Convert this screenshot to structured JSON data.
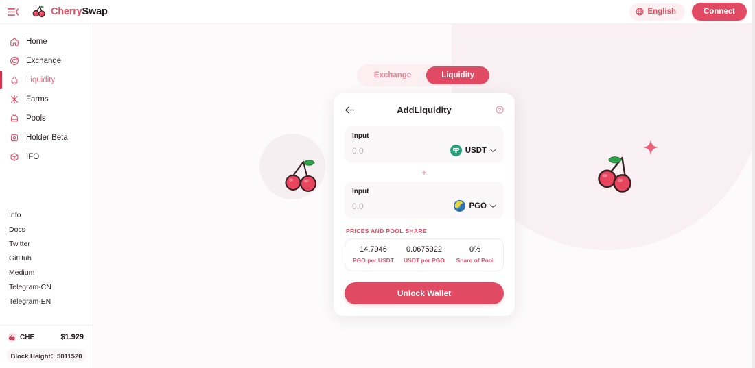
{
  "header": {
    "collapse_icon": "collapse-sidebar-icon",
    "brand": {
      "logo_icon": "cherry-logo-icon",
      "name_primary": "Cherry",
      "name_secondary": "Swap"
    },
    "language_button": {
      "label": "English",
      "icon": "globe-icon"
    },
    "connect_button": {
      "label": "Connect"
    }
  },
  "sidebar": {
    "nav_items": [
      {
        "label": "Home",
        "icon": "home-icon",
        "active": false
      },
      {
        "label": "Exchange",
        "icon": "exchange-icon",
        "active": false
      },
      {
        "label": "Liquidity",
        "icon": "liquidity-drop-icon",
        "active": true
      },
      {
        "label": "Farms",
        "icon": "farms-icon",
        "active": false
      },
      {
        "label": "Pools",
        "icon": "pools-icon",
        "active": false
      },
      {
        "label": "Holder Beta",
        "icon": "holder-lock-icon",
        "active": false
      },
      {
        "label": "IFO",
        "icon": "ifo-box-icon",
        "active": false
      }
    ],
    "links": [
      {
        "label": "Info"
      },
      {
        "label": "Docs"
      },
      {
        "label": "Twitter"
      },
      {
        "label": "GitHub"
      },
      {
        "label": "Medium"
      },
      {
        "label": "Telegram-CN"
      },
      {
        "label": "Telegram-EN"
      }
    ],
    "footer": {
      "token_icon": "che-token-icon",
      "token_symbol": "CHE",
      "token_price": "$1.929",
      "block_height": "Block Height：5011520"
    }
  },
  "main": {
    "tabs": [
      {
        "label": "Exchange",
        "active": false
      },
      {
        "label": "Liquidity",
        "active": true
      }
    ],
    "card": {
      "back_icon": "back-arrow-icon",
      "title": "AddLiquidity",
      "help_icon": "help-circle-icon",
      "inputs": [
        {
          "label": "Input",
          "value": "",
          "placeholder": "0.0",
          "token": {
            "symbol": "USDT",
            "icon": "usdt-token-icon",
            "color": "#26a17b"
          }
        },
        {
          "label": "Input",
          "value": "",
          "placeholder": "0.0",
          "token": {
            "symbol": "PGO",
            "icon": "pgo-token-icon",
            "color": "#2f6fb5"
          }
        }
      ],
      "plus_icon": "plus-icon",
      "prices_section_label": "PRICES AND POOL SHARE",
      "rates": [
        {
          "value": "14.7946",
          "label": "PGO per USDT"
        },
        {
          "value": "0.0675922",
          "label": "USDT per PGO"
        },
        {
          "value": "0%",
          "label": "Share of Pool"
        }
      ],
      "action_button": {
        "label": "Unlock Wallet"
      }
    },
    "decorations": {
      "cherry_left_icon": "cherry-illustration-icon",
      "cherry_right_icon": "cherry-illustration-icon",
      "sparkle_icon": "sparkle-icon"
    }
  },
  "theme": {
    "accent": "#e04a63",
    "accent_soft": "#fbeff1",
    "text": "#1f1a1d",
    "bg": "#fdfafb"
  }
}
